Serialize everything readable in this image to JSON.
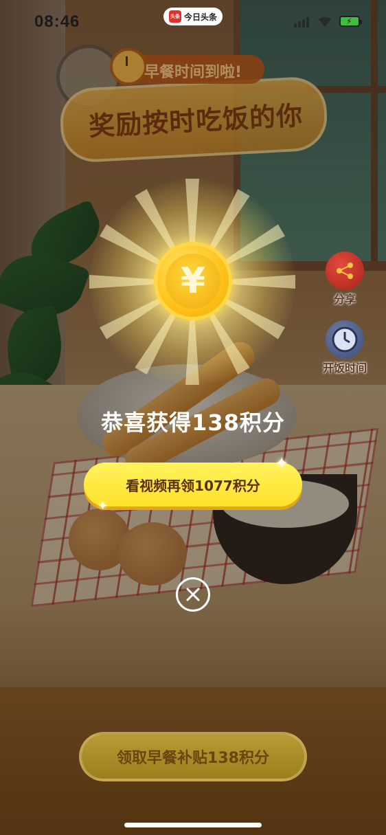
{
  "status_bar": {
    "time": "08:46",
    "app_logo": "头条",
    "app_name": "今日头条"
  },
  "background": {
    "subtitle": "早餐时间到啦!",
    "banner_title": "奖励按时吃饭的你"
  },
  "side_buttons": {
    "share_label": "分享",
    "meal_time_label": "开饭时间"
  },
  "reward_popup": {
    "coin_symbol": "¥",
    "congrats_text": "恭喜获得138积分",
    "video_button_label": "看视频再领1077积分"
  },
  "bottom": {
    "claim_button_label": "领取早餐补贴138积分"
  },
  "colors": {
    "accent_yellow": "#FFE12C",
    "coin_gold": "#FFC21A",
    "text_brown": "#5A2E08"
  },
  "icons": [
    "share-icon",
    "clock-icon",
    "close-icon",
    "coin-icon",
    "signal-icon",
    "wifi-icon",
    "battery-icon"
  ]
}
